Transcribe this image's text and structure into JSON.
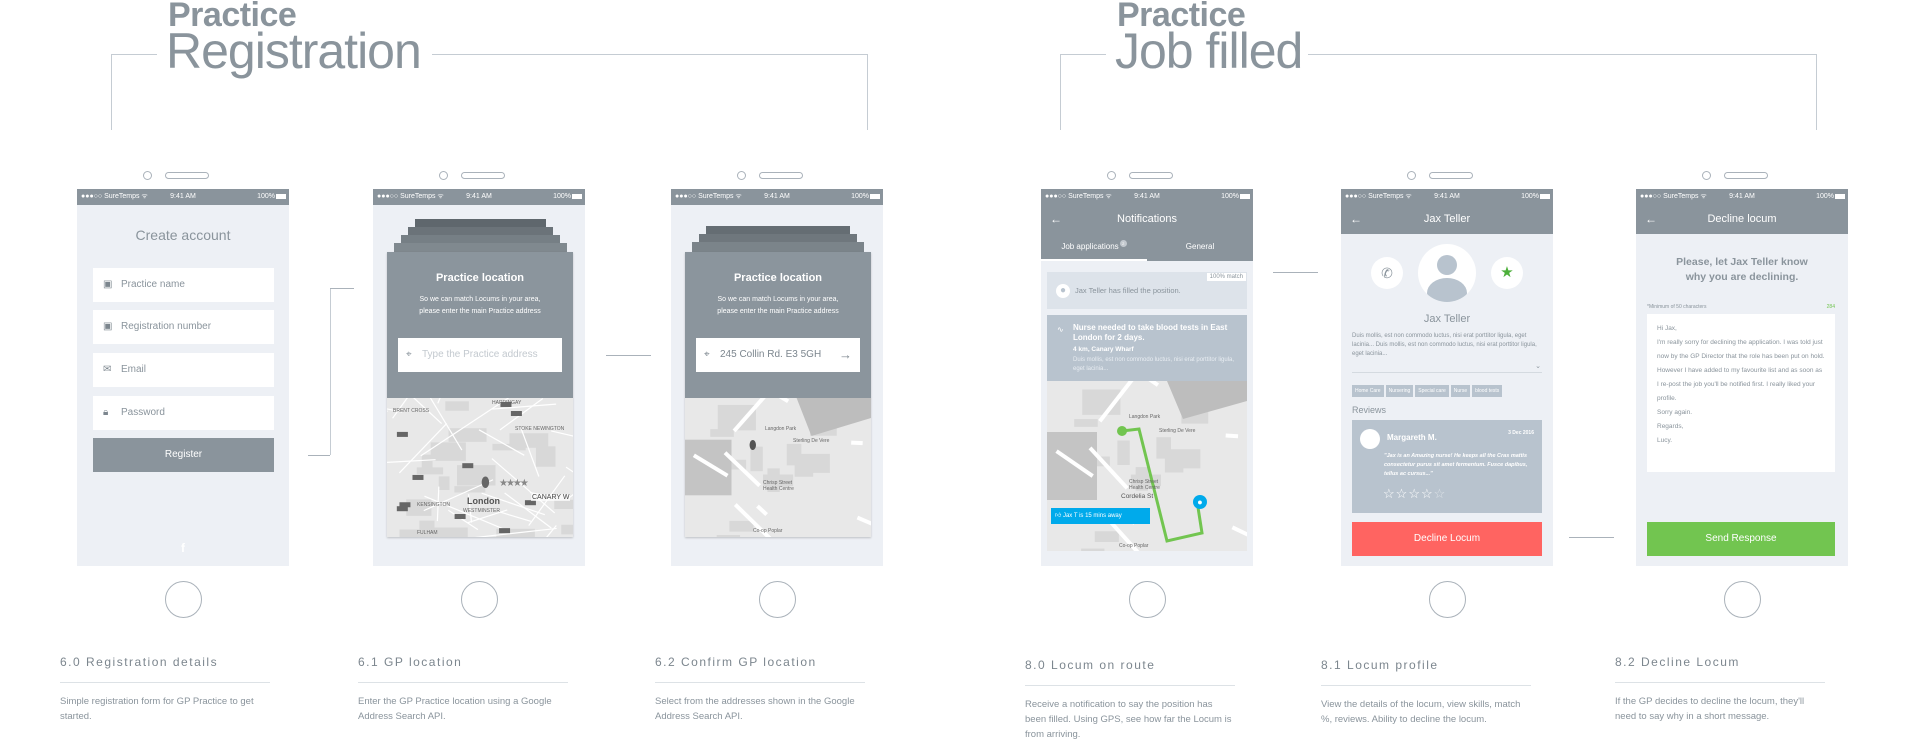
{
  "sections": [
    {
      "bold": "Practice",
      "thin": "Registration"
    },
    {
      "bold": "Practice",
      "thin": "Job filled"
    }
  ],
  "status": {
    "carrier": "●●●○○ SureTemps ᯤ",
    "time": "9:41 AM",
    "battery": "100%"
  },
  "colors": {
    "bar": "#8a949c",
    "screen": "#edf0f5",
    "decline": "#ff6461",
    "send": "#72c550",
    "toast": "#00aaeb",
    "star": "#4caf3a"
  },
  "screens": {
    "register": {
      "title": "Create account",
      "fields": [
        {
          "icon": "user-card-icon",
          "placeholder": "Practice name"
        },
        {
          "icon": "user-card-icon",
          "placeholder": "Registration number"
        },
        {
          "icon": "mail-icon",
          "placeholder": "Email"
        },
        {
          "icon": "lock-icon",
          "placeholder": "Password"
        }
      ],
      "register_label": "Register",
      "facebook": "f"
    },
    "gp_location": {
      "title": "Practice location",
      "subtitle_1": "So we can match Locums in your area,",
      "subtitle_2": "please enter the main Practice address",
      "placeholder": "Type the Practice address",
      "map_labels": {
        "harringay": "HARRINGAY",
        "brent": "BRENT CROSS",
        "stoke": "STOKE NEWINGTON",
        "london": "London",
        "kensington": "KENSINGTON",
        "westminster": "WESTMINSTER",
        "fulham": "FULHAM",
        "canary": "CANARY W"
      }
    },
    "confirm_location": {
      "title": "Practice location",
      "subtitle_1": "So we can match Locums in your area,",
      "subtitle_2": "please enter the main Practice address",
      "value": "245 Collin Rd. E3 5GH"
    },
    "map_street_labels": {
      "langdon": "Langdon Park",
      "sterling": "Sterling De Vere",
      "chrisp": "Chrisp Street Health Centre",
      "coop": "Co-op Poplar",
      "cordelia": "Cordelia St"
    },
    "notifications": {
      "title": "Notifications",
      "tabs": [
        {
          "label": "Job applications",
          "badge": "2",
          "active": true
        },
        {
          "label": "General",
          "active": false
        }
      ],
      "match": "100% match",
      "filled": "Jax Teller has filled the position.",
      "job_title": "Nurse needed to take blood tests in East London for 2 days.",
      "job_location": "4 km, Canary Wharf",
      "job_desc": "Duis mollis, est non commodo luctus, nisi erat porttitor ligula, eget lacinia...",
      "toast": "Jax T is 15 mins away"
    },
    "profile": {
      "title": "Jax Teller",
      "name": "Jax Teller",
      "bio": "Duis mollis, est non commodo luctus, nisi erat porttitor ligula, eget lacinia... Duis mollis, est non commodo luctus, nisi erat porttitor ligula, eget lacinia...",
      "tags": [
        "Home Care",
        "Nursering",
        "Special care",
        "Nurse",
        "blood tests"
      ],
      "reviews_label": "Reviews",
      "review": {
        "author": "Margareth M.",
        "date": "3 Dec 2016",
        "text": "\"Jax is an Amazing nurse! He keeps all the Cras mattis consectetur purus sit amet fermentum. Fusce dapibus, tellus ac cursus...\"",
        "rating": 4,
        "max": 5
      },
      "decline_label": "Decline Locum"
    },
    "decline": {
      "title": "Decline locum",
      "heading_1": "Please, let Jax Teller know",
      "heading_2": "why you are declining.",
      "min_label": "*Minimum of 50 characters",
      "count": "284",
      "message": [
        "Hi Jax,",
        "I'm really sorry for declining the application. I was told just now by the GP Director that the role has been put on hold. However I have added to my favourite list and as soon as I re-post the job you'll be notified first. I really liked your profile.",
        "Sorry again.",
        "Regards,",
        "Lucy."
      ],
      "send_label": "Send Response"
    }
  },
  "captions": [
    {
      "title": "6.0 Registration details",
      "desc": "Simple registration form for GP Practice to get started."
    },
    {
      "title": "6.1 GP location",
      "desc": "Enter the GP Practice location using a Google Address Search API."
    },
    {
      "title": "6.2 Confirm GP location",
      "desc": "Select from the addresses shown in the Google Address Search API."
    },
    {
      "title": "8.0 Locum on route",
      "desc": "Receive a notification to say the position has been filled. Using GPS, see how far the Locum is from arriving."
    },
    {
      "title": "8.1 Locum profile",
      "desc": "View the details of the locum, view skills, match %, reviews. Ability to decline the locum."
    },
    {
      "title": "8.2 Decline Locum",
      "desc": "If the GP decides to decline the locum, they'll need to say why in a short message."
    }
  ]
}
